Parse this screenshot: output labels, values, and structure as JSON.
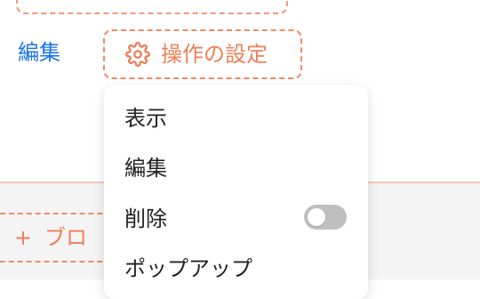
{
  "action_row": {
    "edit_link_label": "編集",
    "settings_button_label": "操作の設定",
    "settings_icon": "gear-icon"
  },
  "add_block": {
    "label": "ブロ",
    "icon": "plus-icon"
  },
  "dropdown": {
    "items": [
      {
        "label": "表示"
      },
      {
        "label": "編集"
      },
      {
        "label": "削除",
        "toggle_on": false
      },
      {
        "label": "ポップアップ"
      }
    ]
  },
  "colors": {
    "accent": "#ef7f57",
    "link": "#1a73e8",
    "toggle_off": "#bfbfbf"
  }
}
